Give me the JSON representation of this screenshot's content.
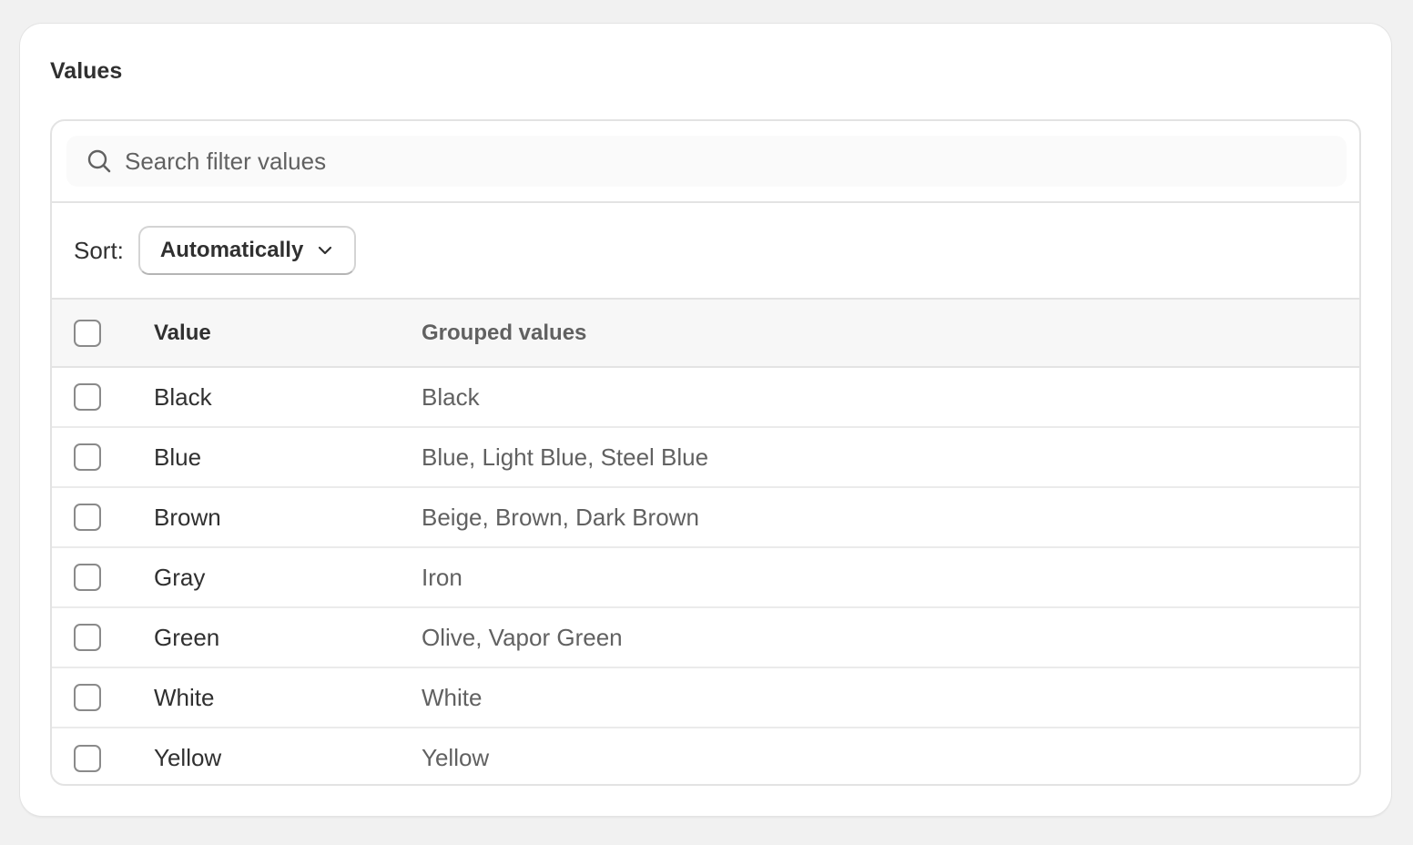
{
  "card": {
    "title": "Values"
  },
  "search": {
    "placeholder": "Search filter values",
    "icon": "search-icon"
  },
  "sort": {
    "label": "Sort:",
    "selected": "Automatically",
    "icon": "chevron-down-icon"
  },
  "table": {
    "headers": {
      "value": "Value",
      "grouped": "Grouped values"
    },
    "rows": [
      {
        "value": "Black",
        "grouped": "Black"
      },
      {
        "value": "Blue",
        "grouped": "Blue, Light Blue, Steel Blue"
      },
      {
        "value": "Brown",
        "grouped": "Beige, Brown, Dark Brown"
      },
      {
        "value": "Gray",
        "grouped": "Iron"
      },
      {
        "value": "Green",
        "grouped": "Olive, Vapor Green"
      },
      {
        "value": "White",
        "grouped": "White"
      },
      {
        "value": "Yellow",
        "grouped": "Yellow"
      }
    ]
  },
  "colors": {
    "background": "#f1f1f1",
    "card": "#ffffff",
    "text": "#303030",
    "muted_text": "#616161",
    "border": "#e3e3e3",
    "header_bg": "#f7f7f7"
  }
}
